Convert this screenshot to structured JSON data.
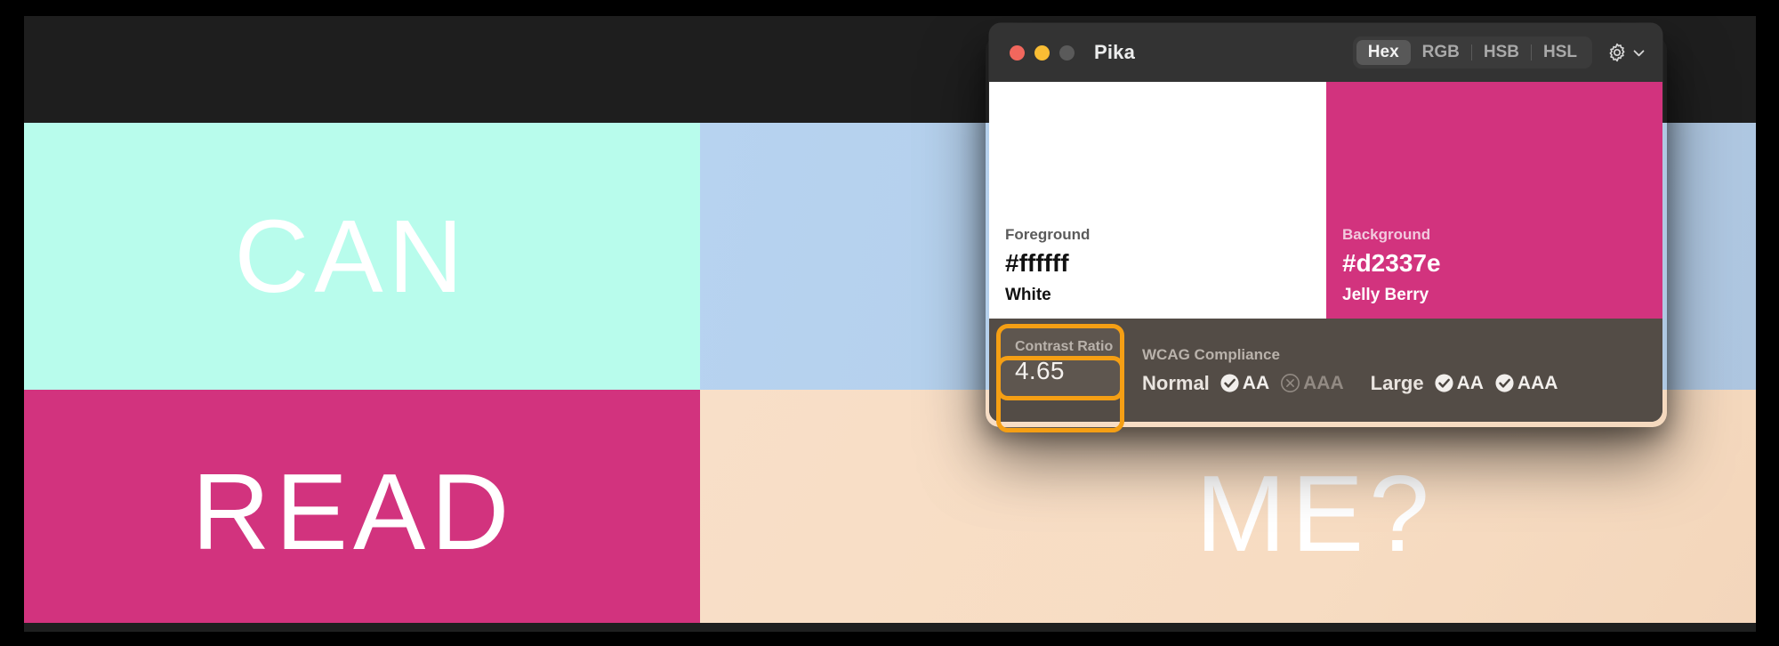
{
  "artwork": {
    "quadrants": [
      {
        "id": "top-left",
        "text": "CAN",
        "color": "#b8fcec"
      },
      {
        "id": "top-right",
        "text": "",
        "color": "#b3cfee"
      },
      {
        "id": "bottom-left",
        "text": "READ",
        "color": "#d2337e"
      },
      {
        "id": "bottom-right",
        "text": "ME?",
        "color": "#f7dcc2"
      }
    ]
  },
  "window": {
    "title": "Pika",
    "traffic_lights": [
      "close",
      "minimize",
      "zoom"
    ],
    "color_modes": [
      "Hex",
      "RGB",
      "HSB",
      "HSL"
    ],
    "active_color_mode": "Hex",
    "settings_icon": "gear-icon",
    "settings_chevron": "chevron-down-icon"
  },
  "foreground": {
    "label": "Foreground",
    "hex": "#ffffff",
    "name": "White",
    "swatch_color": "#ffffff"
  },
  "background": {
    "label": "Background",
    "hex": "#d2337e",
    "name": "Jelly Berry",
    "swatch_color": "#d2337e"
  },
  "contrast": {
    "label": "Contrast Ratio",
    "value": "4.65",
    "highlight_color": "#f59f14"
  },
  "wcag": {
    "title": "WCAG Compliance",
    "groups": [
      {
        "size": "Normal",
        "results": [
          {
            "level": "AA",
            "pass": true,
            "icon": "check-circle-icon"
          },
          {
            "level": "AAA",
            "pass": false,
            "icon": "x-circle-icon"
          }
        ]
      },
      {
        "size": "Large",
        "results": [
          {
            "level": "AA",
            "pass": true,
            "icon": "check-circle-icon"
          },
          {
            "level": "AAA",
            "pass": true,
            "icon": "check-circle-icon"
          }
        ]
      }
    ]
  }
}
